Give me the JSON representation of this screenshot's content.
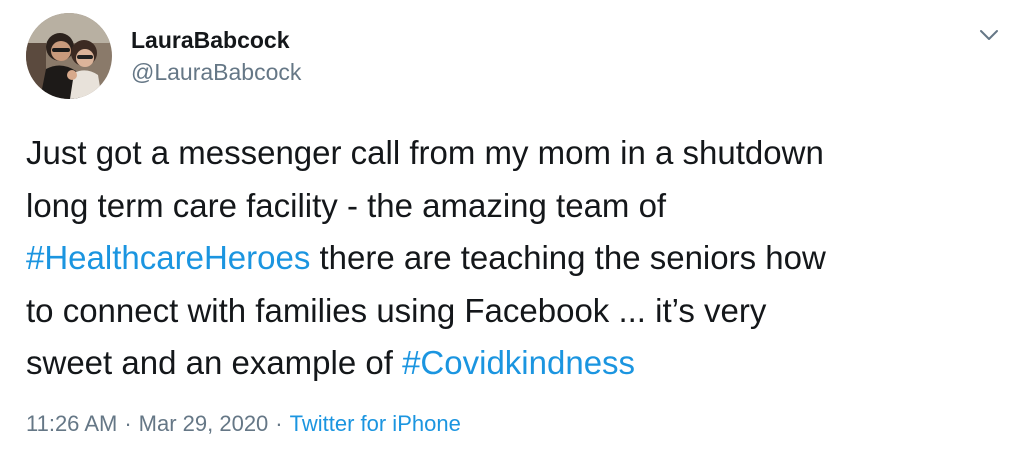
{
  "user": {
    "display_name": "LauraBabcock",
    "handle": "@LauraBabcock"
  },
  "tweet": {
    "lines": [
      [
        {
          "text": "Just got a messenger call from my mom in a shutdown",
          "hashtag": false
        }
      ],
      [
        {
          "text": "long term care facility - the amazing team of",
          "hashtag": false
        }
      ],
      [
        {
          "text": "#HealthcareHeroes",
          "hashtag": true
        },
        {
          "text": " there are teaching the seniors how",
          "hashtag": false
        }
      ],
      [
        {
          "text": "to connect with families using Facebook ... it’s very",
          "hashtag": false
        }
      ],
      [
        {
          "text": "sweet and an example of ",
          "hashtag": false
        },
        {
          "text": "#Covidkindness",
          "hashtag": true
        }
      ]
    ]
  },
  "meta": {
    "time": "11:26 AM",
    "separator": "·",
    "date": "Mar 29, 2020",
    "source": "Twitter for iPhone"
  },
  "icons": {
    "more": "chevron-down-icon",
    "avatar": "profile-photo"
  },
  "colors": {
    "link": "#1b95e0",
    "secondary_text": "#657786",
    "primary_text": "#14171a"
  }
}
